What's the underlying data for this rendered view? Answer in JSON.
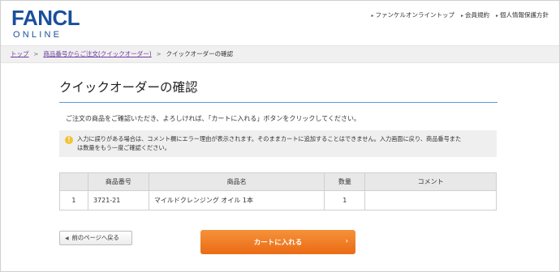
{
  "header": {
    "logo_main": "FANCL",
    "logo_sub": "ONLINE",
    "nav": [
      {
        "label": "ファンケルオンライントップ"
      },
      {
        "label": "会員規約"
      },
      {
        "label": "個人情報保護方針"
      }
    ],
    "nav_bullet": "▸"
  },
  "breadcrumb": {
    "items": [
      {
        "label": "トップ"
      },
      {
        "label": "商品番号からご注文(クイックオーダー)"
      },
      {
        "label": "クイックオーダーの確認"
      }
    ],
    "separator": ">"
  },
  "main": {
    "title": "クイックオーダーの確認",
    "instruction": "ご注文の商品をご確認いただき、よろしければ、「カートに入れる」ボタンをクリックしてください。",
    "notice": {
      "icon": "!",
      "line1": "入力に誤りがある場合は、コメント欄にエラー理由が表示されます。そのままカートに追加することはできません。入力画面に戻り、商品番号また",
      "line2": "は数量をもう一度ご確認ください。"
    },
    "table": {
      "headers": [
        "",
        "商品番号",
        "商品名",
        "数量",
        "コメント"
      ],
      "rows": [
        {
          "no": "1",
          "code": "3721-21",
          "name": "マイルドクレンジング オイル 1本",
          "qty": "1",
          "comment": ""
        }
      ]
    },
    "back_button": {
      "label": "前のページへ戻る",
      "icon": "◀"
    },
    "cart_button": {
      "label": "カートに入れる",
      "icon": "›"
    }
  },
  "colors": {
    "brand": "#1a4f9c",
    "accent_orange": "#ea6b14",
    "title_rule": "#5b9bd5",
    "link_purple": "#6b3aa0",
    "warning_yellow": "#f2c230"
  }
}
